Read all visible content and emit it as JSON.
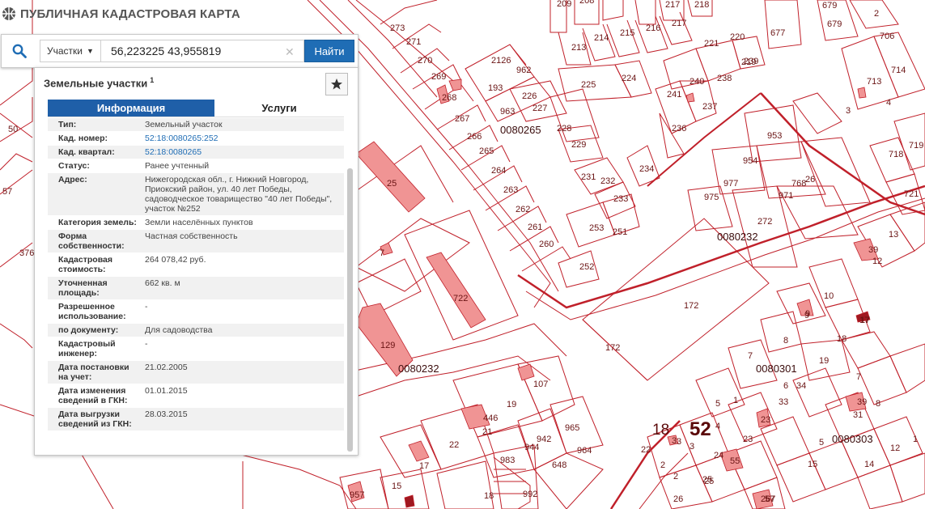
{
  "app": {
    "title": "ПУБЛИЧНАЯ КАДАСТРОВАЯ КАРТА"
  },
  "search": {
    "type_label": "Участки",
    "query": "56,223225 43,955819",
    "button_label": "Найти",
    "clear_glyph": "✕"
  },
  "panel": {
    "title": "Земельные участки",
    "title_count": "1",
    "tabs": [
      "Информация",
      "Услуги"
    ],
    "rows": [
      {
        "k": "Тип:",
        "v": "Земельный участок"
      },
      {
        "k": "Кад. номер:",
        "v": "52:18:0080265:252"
      },
      {
        "k": "Кад. квартал:",
        "v": "52:18:0080265"
      },
      {
        "k": "Статус:",
        "v": "Ранее учтенный"
      },
      {
        "k": "Адрес:",
        "v": "Нижегородская обл., г. Нижний Новгород, Приокский район, ул. 40 лет Победы, садоводческое товарищество \"40 лет Победы\", участок №252"
      },
      {
        "k": "Категория земель:",
        "v": "Земли населённых пунктов"
      },
      {
        "k": "Форма собственности:",
        "v": "Частная собственность"
      },
      {
        "k": "Кадастровая стоимость:",
        "v": "264 078,42 руб."
      },
      {
        "k": "Уточненная площадь:",
        "v": "662 кв. м"
      },
      {
        "k": "Разрешенное использование:",
        "v": "-"
      },
      {
        "k": "по документу:",
        "v": "Для садоводства"
      },
      {
        "k": "Кадастровый инженер:",
        "v": "-"
      },
      {
        "k": "Дата постановки на учет:",
        "v": "21.02.2005"
      },
      {
        "k": "Дата изменения сведений в ГКН:",
        "v": "01.01.2015"
      },
      {
        "k": "Дата выгрузки сведений из ГКН:",
        "v": "28.03.2015"
      }
    ]
  },
  "map": {
    "colors": {
      "parcel_line": "#c0202a",
      "building": "#f09494",
      "building_stroke": "#c0202a"
    },
    "quarter_labels": [
      "0080265",
      "0080232",
      "0080232",
      "0080301",
      "0080303"
    ],
    "zone_labels": [
      "18",
      "52"
    ],
    "parcel_labels": [
      "209",
      "208",
      "217",
      "218",
      "679",
      "679",
      "677",
      "213",
      "214",
      "215",
      "216",
      "217",
      "221",
      "220",
      "219",
      "273",
      "271",
      "270",
      "269",
      "2126",
      "962",
      "193",
      "225",
      "224",
      "240",
      "238",
      "239",
      "241",
      "237",
      "236",
      "268",
      "267",
      "266",
      "265",
      "264",
      "263",
      "262",
      "261",
      "260",
      "963",
      "226",
      "227",
      "228",
      "229",
      "231",
      "232",
      "233",
      "234",
      "253",
      "251",
      "252",
      "953",
      "954",
      "977",
      "971",
      "26",
      "975",
      "272",
      "172",
      "172",
      "13",
      "12",
      "10",
      "9",
      "17",
      "8",
      "18",
      "19",
      "7",
      "34",
      "3",
      "107",
      "19",
      "21",
      "22",
      "17",
      "965",
      "964",
      "942",
      "944",
      "648",
      "983",
      "992",
      "15",
      "18",
      "22",
      "23",
      "24",
      "25",
      "2",
      "3",
      "4",
      "5",
      "1",
      "33",
      "6",
      "31",
      "5",
      "15",
      "14",
      "12",
      "1",
      "7",
      "8",
      "768",
      "706",
      "713",
      "714",
      "718",
      "719",
      "721",
      "3",
      "2",
      "25",
      "7",
      "50",
      "57",
      "376",
      "2",
      "3",
      "4"
    ],
    "building_labels": [
      "25",
      "722",
      "129",
      "446",
      "39",
      "9",
      "17",
      "39",
      "23",
      "55",
      "267",
      "957",
      "26",
      "57"
    ],
    "zoom_labels": [
      "0080265"
    ]
  }
}
